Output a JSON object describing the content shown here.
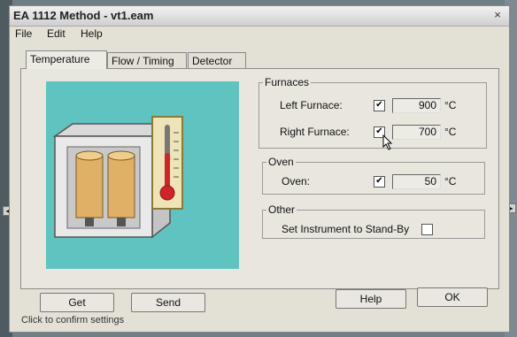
{
  "window": {
    "title": "EA 1112 Method - vt1.eam",
    "close_glyph": "×"
  },
  "menu": {
    "items": [
      "File",
      "Edit",
      "Help"
    ]
  },
  "tabs": [
    "Temperature",
    "Flow / Timing",
    "Detector"
  ],
  "furnaces": {
    "legend": "Furnaces",
    "left": {
      "label": "Left Furnace:",
      "checked": true,
      "value": "900",
      "unit": "°C"
    },
    "right": {
      "label": "Right Furnace:",
      "checked": true,
      "value": "700",
      "unit": "°C"
    }
  },
  "oven": {
    "legend": "Oven",
    "row": {
      "label": "Oven:",
      "checked": true,
      "value": "50",
      "unit": "°C"
    }
  },
  "other": {
    "legend": "Other",
    "standby": {
      "label": "Set Instrument to Stand-By",
      "checked": false
    }
  },
  "buttons": {
    "get": "Get",
    "send": "Send",
    "help": "Help",
    "ok": "OK"
  },
  "status": "Click to confirm settings",
  "icons": {
    "check": "✔",
    "scroll_left": "◂",
    "scroll_right": "▸"
  },
  "colors": {
    "illustration_bg": "#5fc4bf",
    "thermometer_red": "#d0242a",
    "furnace_tube": "#e0b066"
  }
}
